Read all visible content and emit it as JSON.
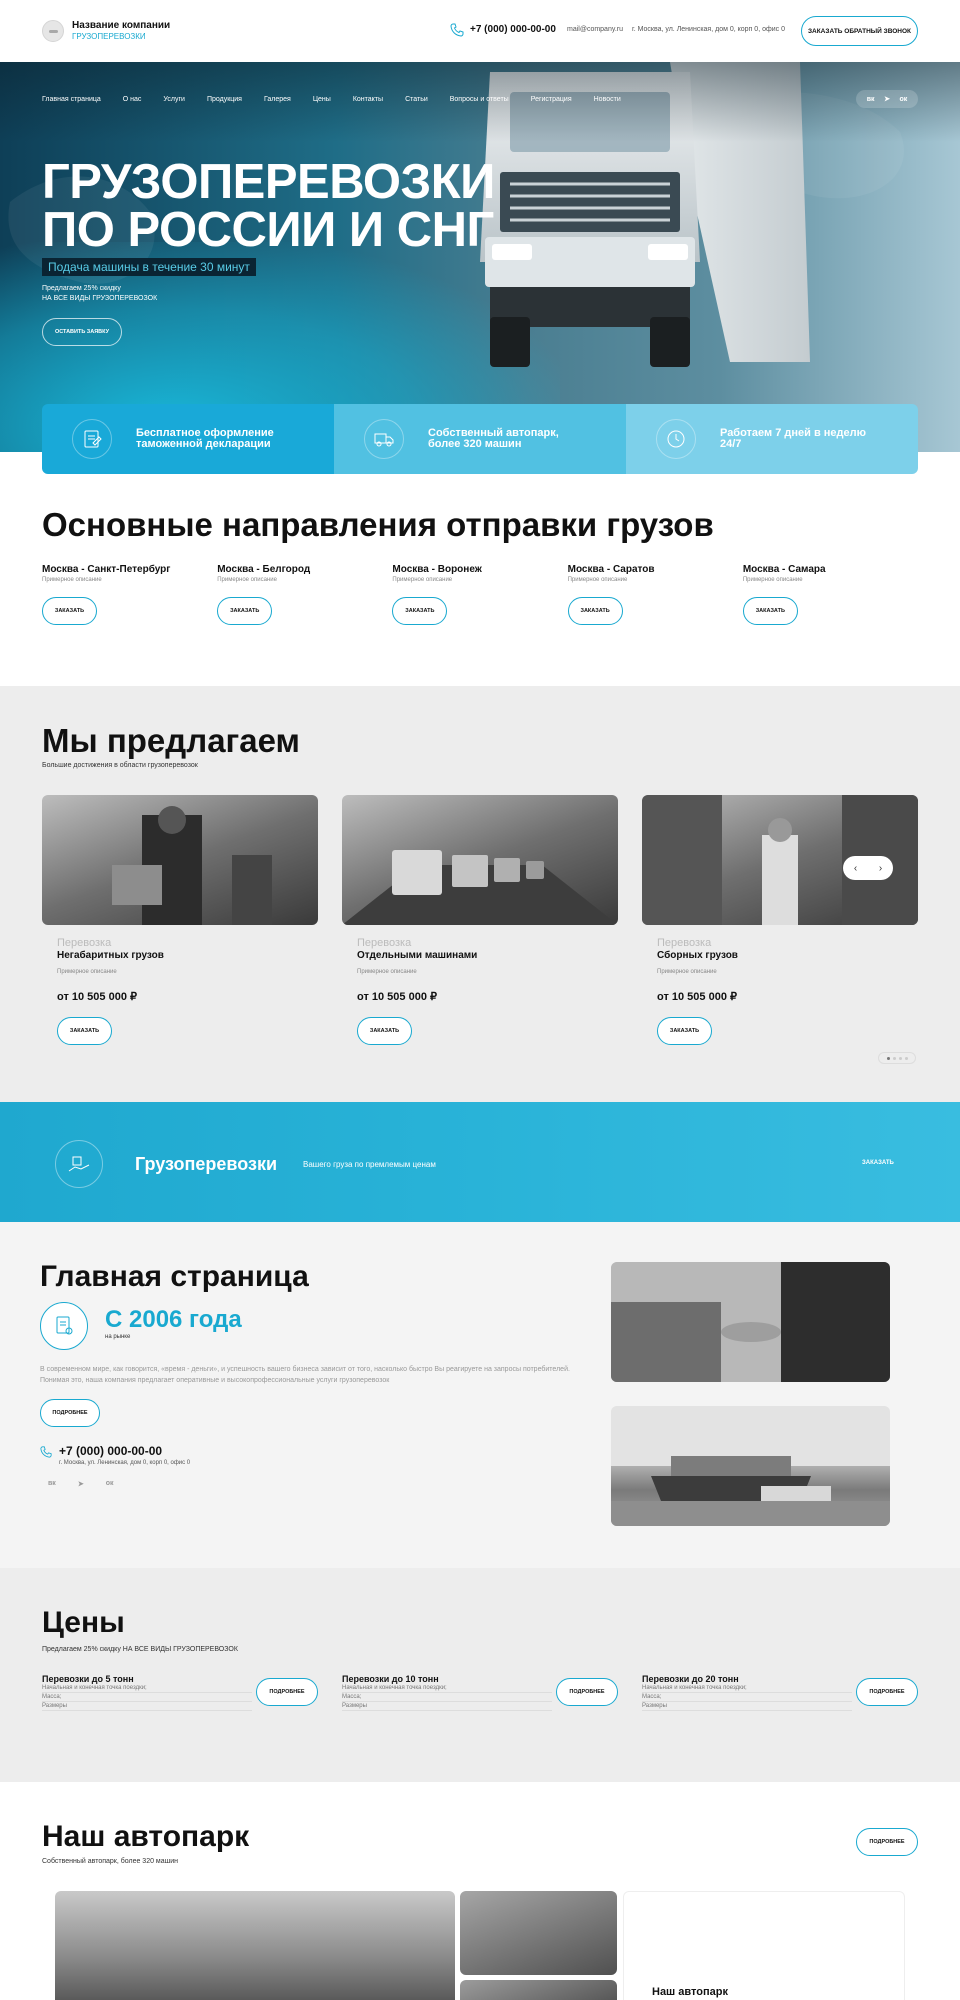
{
  "header": {
    "company_name": "Название компании",
    "company_sub": "ГРУЗОПЕРЕВОЗКИ",
    "phone": "+7 (000) 000-00-00",
    "email": "mail@company.ru",
    "address": "г. Москва, ул. Ленинская, дом 0, корп 0, офис 0",
    "callback_label": "ЗАКАЗАТЬ ОБРАТНЫЙ ЗВОНОК"
  },
  "nav": {
    "items": [
      {
        "label": "Главная страница"
      },
      {
        "label": "О нас"
      },
      {
        "label": "Услуги"
      },
      {
        "label": "Продукция"
      },
      {
        "label": "Галерея"
      },
      {
        "label": "Цены"
      },
      {
        "label": "Контакты"
      },
      {
        "label": "Статьи"
      },
      {
        "label": "Вопросы и ответы"
      },
      {
        "label": "Регистрация"
      },
      {
        "label": "Новости"
      }
    ],
    "socials": [
      "vk-icon",
      "telegram-icon",
      "odnoklassniki-icon"
    ]
  },
  "hero": {
    "title_line1": "ГРУЗОПЕРЕВОЗКИ",
    "title_line2": "ПО РОССИИ И СНГ",
    "badge": "Подача машины в течение 30 минут",
    "promo_line1": "Предлагаем 25% скидку",
    "promo_line2": "НА ВСЕ ВИДЫ ГРУЗОПЕРЕВОЗОК",
    "button_label": "ОСТАВИТЬ ЗАЯВКУ"
  },
  "features": [
    {
      "text": "Бесплатное оформление таможенной декларации",
      "icon": "customs-declaration-icon"
    },
    {
      "text": "Собственный автопарк, более 320 машин",
      "icon": "truck-icon"
    },
    {
      "text": "Работаем 7 дней в неделю 24/7",
      "icon": "clock-24-icon"
    }
  ],
  "directions": {
    "title": "Основные направления отправки грузов",
    "items": [
      {
        "name": "Москва - Санкт-Петербург",
        "desc": "Примерное описание",
        "button": "ЗАКАЗАТЬ"
      },
      {
        "name": "Москва - Белгород",
        "desc": "Примерное описание",
        "button": "ЗАКАЗАТЬ"
      },
      {
        "name": "Москва - Воронеж",
        "desc": "Примерное описание",
        "button": "ЗАКАЗАТЬ"
      },
      {
        "name": "Москва - Саратов",
        "desc": "Примерное описание",
        "button": "ЗАКАЗАТЬ"
      },
      {
        "name": "Москва - Самара",
        "desc": "Примерное описание",
        "button": "ЗАКАЗАТЬ"
      }
    ]
  },
  "offer": {
    "title": "Мы предлагаем",
    "subtitle": "Большие достижения в области грузоперевозок",
    "cards": [
      {
        "category": "Перевозка",
        "name": "Негабаритных грузов",
        "desc": "Примерное описание",
        "price": "от 10 505 000 ₽",
        "button": "ЗАКАЗАТЬ"
      },
      {
        "category": "Перевозка",
        "name": "Отдельными машинами",
        "desc": "Примерное описание",
        "price": "от 10 505 000 ₽",
        "button": "ЗАКАЗАТЬ"
      },
      {
        "category": "Перевозка",
        "name": "Сборных грузов",
        "desc": "Примерное описание",
        "price": "от 10 505 000 ₽",
        "button": "ЗАКАЗАТЬ"
      }
    ],
    "arrow_prev": "‹",
    "arrow_next": "›"
  },
  "banner": {
    "title": "Грузоперевозки",
    "subtitle": "Вашего груза по премлемым ценам",
    "cta": "ЗАКАЗАТЬ"
  },
  "about": {
    "title": "Главная страница",
    "since_year": "С 2006 года",
    "since_sub": "на рынке",
    "text": "В современном мире, как говорится, «время - деньги», и успешность вашего бизнеса зависит от того, насколько быстро Вы реагируете на запросы потребителей. Понимая это, наша компания предлагает оперативные и высокопрофессиональные услуги грузоперевозок",
    "more_label": "ПОДРОБНЕЕ",
    "phone": "+7 (000) 000-00-00",
    "address": "г. Москва, ул. Ленинская, дом 0, корп 0, офис 0",
    "socials": [
      "vk-icon",
      "telegram-icon",
      "odnoklassniki-icon"
    ]
  },
  "prices": {
    "title": "Цены",
    "subtitle": "Предлагаем 25% скидку НА ВСЕ ВИДЫ ГРУЗОПЕРЕВОЗОК",
    "items": [
      {
        "name": "Перевозки до 5 тонн",
        "line1": "Начальная и конечная точка поездки;",
        "line2": "Масса;",
        "line3": "Размеры",
        "button": "ПОДРОБНЕЕ"
      },
      {
        "name": "Перевозки до 10 тонн",
        "line1": "Начальная и конечная точка поездки;",
        "line2": "Масса;",
        "line3": "Размеры",
        "button": "ПОДРОБНЕЕ"
      },
      {
        "name": "Перевозки до 20 тонн",
        "line1": "Начальная и конечная точка поездки;",
        "line2": "Масса;",
        "line3": "Размеры",
        "button": "ПОДРОБНЕЕ"
      }
    ]
  },
  "fleet": {
    "title": "Наш автопарк",
    "subtitle": "Собственный автопарк, более 320 машин",
    "button": "ПОДРОБНЕЕ",
    "card_title": "Наш автопарк"
  },
  "colors": {
    "accent": "#19a9d0",
    "banner": "#29b3d8",
    "section_gray": "#ededed"
  }
}
